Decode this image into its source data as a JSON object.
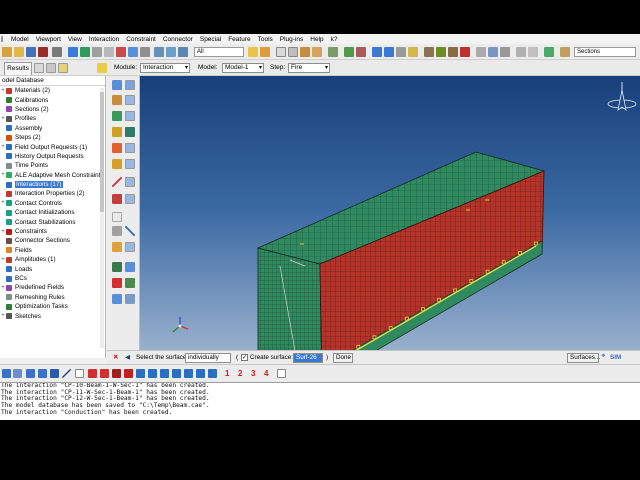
{
  "menu": {
    "items": [
      "Model",
      "Viewport",
      "View",
      "Interaction",
      "Constraint",
      "Connector",
      "Special",
      "Feature",
      "Tools",
      "Plug-ins",
      "Help",
      "k?"
    ]
  },
  "toolbar": {
    "filter_value": "All",
    "sections_value": "Sections"
  },
  "modulebar": {
    "results_tab": "Results",
    "module_label": "Module:",
    "module_value": "Interaction",
    "model_label": "Model:",
    "model_value": "Model-1",
    "step_label": "Step:",
    "step_value": "Fire"
  },
  "tree": {
    "header": "odel Database",
    "items": [
      {
        "label": "Materials (2)",
        "color": "#c0392b"
      },
      {
        "label": "Calibrations",
        "color": "#2e7d32"
      },
      {
        "label": "Sections (2)",
        "color": "#8e44ad"
      },
      {
        "label": "Profiles",
        "color": "#555555"
      },
      {
        "label": "Assembly",
        "color": "#2a6fbf"
      },
      {
        "label": "Steps (2)",
        "color": "#d35400"
      },
      {
        "label": "Field Output Requests (1)",
        "color": "#2a6fbf"
      },
      {
        "label": "History Output Requests",
        "color": "#2a6fbf"
      },
      {
        "label": "Time Points",
        "color": "#7f8c8d"
      },
      {
        "label": "ALE Adaptive Mesh Constraints",
        "color": "#27ae60"
      },
      {
        "label": "Interactions (17)",
        "color": "#2a6fbf"
      },
      {
        "label": "Interaction Properties (2)",
        "color": "#c0392b"
      },
      {
        "label": "Contact Controls",
        "color": "#16a085"
      },
      {
        "label": "Contact Initializations",
        "color": "#16a085"
      },
      {
        "label": "Contact Stabilizations",
        "color": "#16a085"
      },
      {
        "label": "Constraints",
        "color": "#b71c1c"
      },
      {
        "label": "Connector Sections",
        "color": "#6d4c41"
      },
      {
        "label": "Fields",
        "color": "#e67e22"
      },
      {
        "label": "Amplitudes (1)",
        "color": "#c0392b"
      },
      {
        "label": "Loads",
        "color": "#2a6fbf"
      },
      {
        "label": "BCs",
        "color": "#2a6fbf"
      },
      {
        "label": "Predefined Fields",
        "color": "#8e44ad"
      },
      {
        "label": "Remeshing Rules",
        "color": "#7f8c8d"
      },
      {
        "label": "Optimization Tasks",
        "color": "#2e7d32"
      },
      {
        "label": "Sketches",
        "color": "#555555"
      }
    ],
    "selected_index": 10
  },
  "prompt": {
    "select_label": "Select the surface",
    "select_value": "individually",
    "create_label": "Create surface:",
    "surface_name": "Surf-26",
    "done_label": "Done",
    "surfaces_button": "Surfaces...",
    "brand": "SIM"
  },
  "status": {
    "numbers": [
      "1",
      "2",
      "3",
      "4"
    ]
  },
  "messages": [
    "The interaction \"CP-10-Beam-1-W-Sec-1\" has been created.",
    "The interaction \"CP-11-W-Sec-1-Beam-1\" has been created.",
    "The interaction \"CP-12-W-Sec-1-Beam-1\" has been created.",
    "The model database has been saved to \"C:\\Temp\\Beam.cae\".",
    "The interaction \"Conduction\" has been created."
  ],
  "colors": {
    "viewport_top": "#17407a",
    "viewport_bottom": "#9db4cf",
    "mesh_green": "#2f8a5f",
    "mesh_red": "#b5342a",
    "selection_yellow": "#f0e040"
  }
}
